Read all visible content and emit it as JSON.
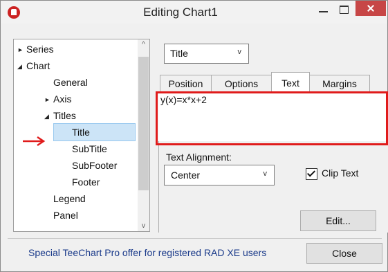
{
  "window": {
    "title": "Editing Chart1"
  },
  "tree": {
    "items": [
      {
        "label": "Series",
        "arrow": "►"
      },
      {
        "label": "Chart",
        "arrow": "◢"
      },
      {
        "label": "General",
        "arrow": ""
      },
      {
        "label": "Axis",
        "arrow": "►"
      },
      {
        "label": "Titles",
        "arrow": "◢"
      },
      {
        "label": "Title",
        "arrow": "",
        "selected": true
      },
      {
        "label": "SubTitle",
        "arrow": ""
      },
      {
        "label": "SubFooter",
        "arrow": ""
      },
      {
        "label": "Footer",
        "arrow": ""
      },
      {
        "label": "Legend",
        "arrow": ""
      },
      {
        "label": "Panel",
        "arrow": ""
      }
    ],
    "scroll_up": "^",
    "scroll_down": "v"
  },
  "title_selector": {
    "value": "Title",
    "chevron": "v"
  },
  "tabs": [
    "Position",
    "Options",
    "Text",
    "Margins"
  ],
  "active_tab": "Text",
  "text": {
    "value": "y(x)=x*x+2"
  },
  "alignment": {
    "label": "Text Alignment:",
    "value": "Center",
    "chevron": "v"
  },
  "clip_text": {
    "label": "Clip Text",
    "checked": true
  },
  "buttons": {
    "edit": "Edit...",
    "close": "Close"
  },
  "status": {
    "text": "Special TeeChart Pro offer for registered RAD XE users"
  },
  "colors": {
    "highlight_red": "#e01b1b",
    "selection": "#cce4f7",
    "link_blue": "#1a3a8a"
  }
}
